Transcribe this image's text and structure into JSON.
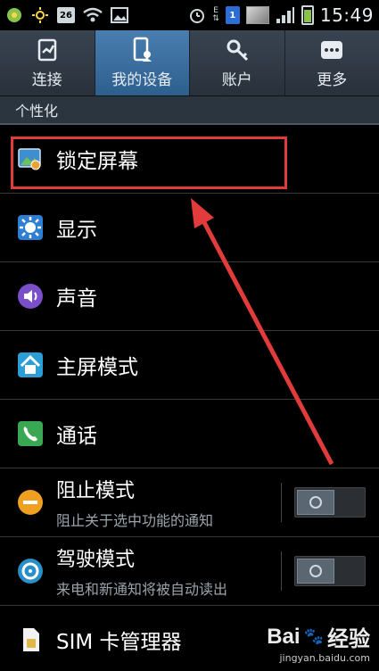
{
  "status_bar": {
    "date_badge": "26",
    "sim_badge": "1",
    "network_badge": "E",
    "time": "15:49",
    "icons": [
      "notification-icon",
      "brightness-icon",
      "calendar-icon",
      "wifi-icon",
      "image-icon",
      "alarm-icon",
      "network-icon",
      "sim-icon",
      "thumbnail-icon",
      "signal-icon",
      "battery-icon"
    ]
  },
  "tabs": [
    {
      "label": "连接",
      "icon": "connection-icon",
      "active": false
    },
    {
      "label": "我的设备",
      "icon": "device-icon",
      "active": true
    },
    {
      "label": "账户",
      "icon": "key-icon",
      "active": false
    },
    {
      "label": "更多",
      "icon": "more-icon",
      "active": false
    }
  ],
  "section_title": "个性化",
  "items": [
    {
      "title": "锁定屏幕",
      "icon": "lockscreen-icon"
    },
    {
      "title": "显示",
      "icon": "display-icon"
    },
    {
      "title": "声音",
      "icon": "sound-icon"
    },
    {
      "title": "主屏模式",
      "icon": "home-icon"
    },
    {
      "title": "通话",
      "icon": "phone-icon"
    },
    {
      "title": "阻止模式",
      "subtitle": "阻止关于选中功能的通知",
      "icon": "block-icon",
      "toggle": "off"
    },
    {
      "title": "驾驶模式",
      "subtitle": "来电和新通知将被自动读出",
      "icon": "driving-icon",
      "toggle": "off"
    },
    {
      "title": "SIM 卡管理器",
      "icon": "sim-card-icon"
    }
  ],
  "watermark": {
    "brand": "Bai",
    "brand2": "经验",
    "url": "jingyan.baidu.com"
  },
  "colors": {
    "accent": "#e23b3b",
    "tab_active": "#3b6fa0"
  }
}
